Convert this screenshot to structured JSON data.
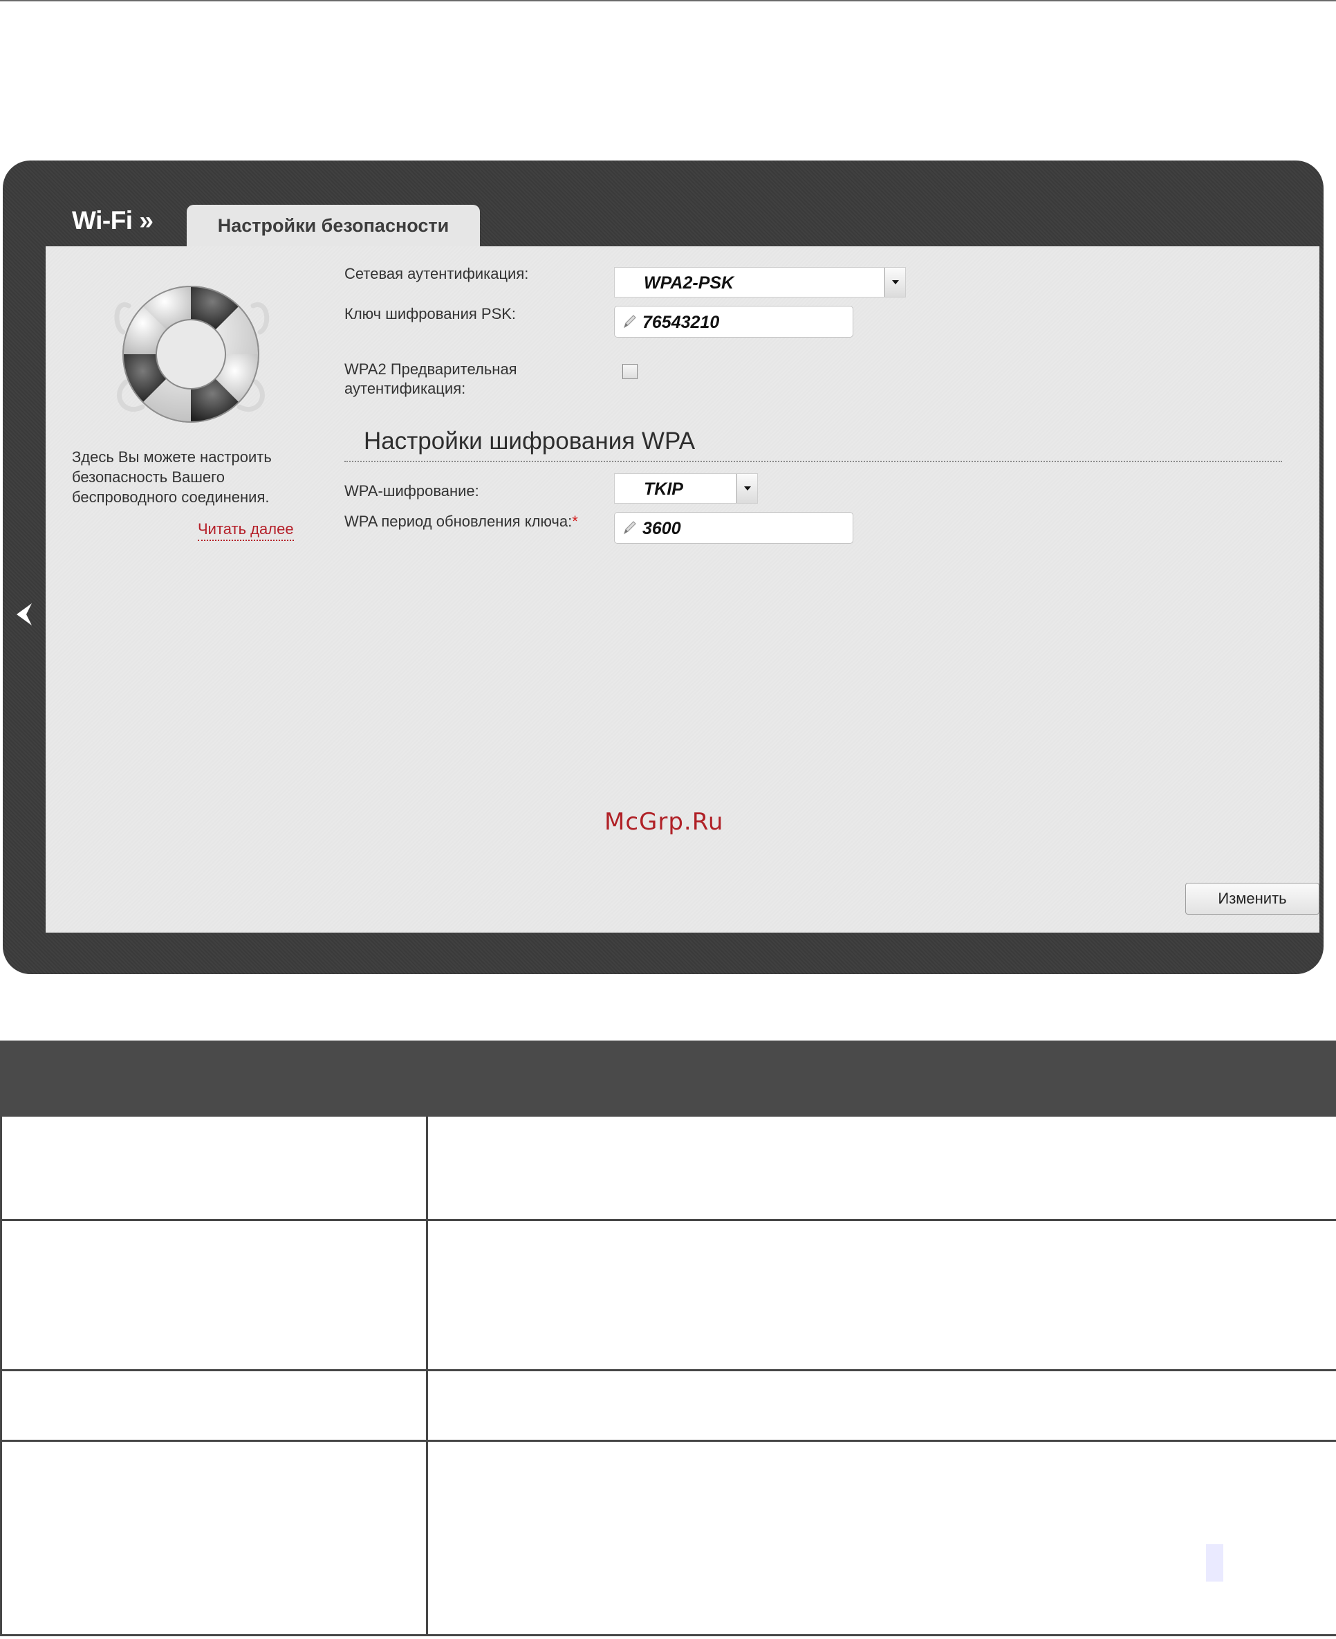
{
  "header": {
    "section_title": "Wi-Fi »",
    "active_tab": "Настройки безопасности"
  },
  "sidebar": {
    "help_text": "Здесь Вы можете настроить безопасность Вашего беспроводного соединения.",
    "read_more": "Читать далее"
  },
  "form": {
    "auth_label": "Сетевая аутентификация:",
    "auth_value": "WPA2-PSK",
    "psk_label": "Ключ шифрования PSK:",
    "psk_value": "76543210",
    "preauth_label": "WPA2 Предварительная аутентификация:",
    "preauth_checked": false,
    "wpa_section_title": "Настройки шифрования WPA",
    "wpa_cipher_label": "WPA-шифрование:",
    "wpa_cipher_value": "TKIP",
    "rekey_label": "WPA период обновления ключа:",
    "rekey_required_mark": "*",
    "rekey_value": "3600",
    "change_button": "Изменить"
  },
  "watermark": "McGrp.Ru",
  "colors": {
    "frame_dark": "#3c3c3c",
    "panel": "#e9e9e9",
    "link_red": "#b5202a",
    "table_header": "#4a4a4a"
  },
  "icons": {
    "back": "chevron-left-icon",
    "logo": "lifebuoy-icon",
    "field": "pencil-icon"
  }
}
